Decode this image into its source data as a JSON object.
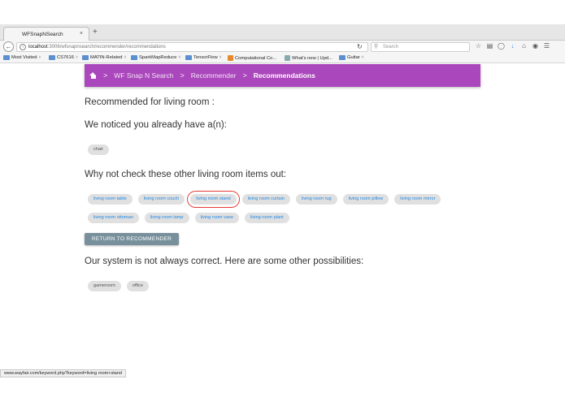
{
  "browser": {
    "tab_title": "WFSnapNSearch",
    "tab_close": "×",
    "new_tab": "+",
    "url_host": "localhost",
    "url_rest": ":3006/wfsnapnsearch/recommender/recommendations",
    "search_placeholder": "Search",
    "bookmarks": [
      {
        "label": "Most Visited",
        "chev": "˅"
      },
      {
        "label": "CS7616",
        "chev": "˅"
      },
      {
        "label": "MATIN-Related",
        "chev": "˅"
      },
      {
        "label": "SparkMapReduce",
        "chev": "˅"
      },
      {
        "label": "TensorFlow",
        "chev": "˅"
      },
      {
        "label": "Computational Co...",
        "chev": ""
      },
      {
        "label": "What's new | Upd...",
        "chev": ""
      },
      {
        "label": "Guitar",
        "chev": "˅"
      }
    ],
    "status_url": "www.wayfair.com/keyword.php?keyword=living room+stand"
  },
  "header": {
    "breadcrumb": [
      "WF Snap N Search",
      "Recommender",
      "Recommendations"
    ],
    "separator": ">"
  },
  "main": {
    "title": "Recommended for living room :",
    "noticed_heading": "We noticed you already have a(n):",
    "owned_items": [
      "chair"
    ],
    "suggest_heading": "Why not check these other living room items out:",
    "suggested_items_row1": [
      "living room table",
      "living room couch",
      "living room stand",
      "living room curtain",
      "living room rug",
      "living room pillow",
      "living room mirror"
    ],
    "suggested_items_row2": [
      "living room ottoman",
      "living room lamp",
      "living room vase",
      "living room plant"
    ],
    "return_button": "RETURN TO RECOMMENDER",
    "alt_heading": "Our system is not always correct. Here are some other possibilities:",
    "alt_items": [
      "gameroom",
      "office"
    ]
  },
  "colors": {
    "header_bg": "#ab47bc",
    "chip_link": "#1e88e5",
    "button_bg": "#78909c",
    "highlight_circle": "#e53935"
  }
}
